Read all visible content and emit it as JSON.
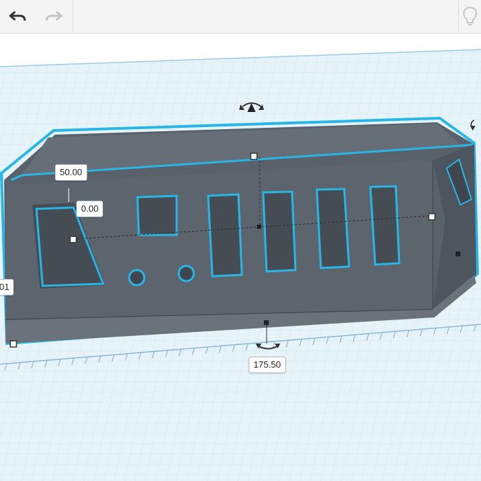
{
  "toolbar": {
    "undo_icon": "undo-arrow-icon",
    "redo_icon": "redo-arrow-icon",
    "hint_icon": "lightbulb-icon"
  },
  "dimensions": {
    "height": "50.00",
    "elevation": "0.00",
    "depth_partial": "01",
    "width": "175.50"
  },
  "colors": {
    "selection_outline": "#29b6e6",
    "shape_body": "#57606a",
    "grid_background": "#e4f2f8"
  }
}
